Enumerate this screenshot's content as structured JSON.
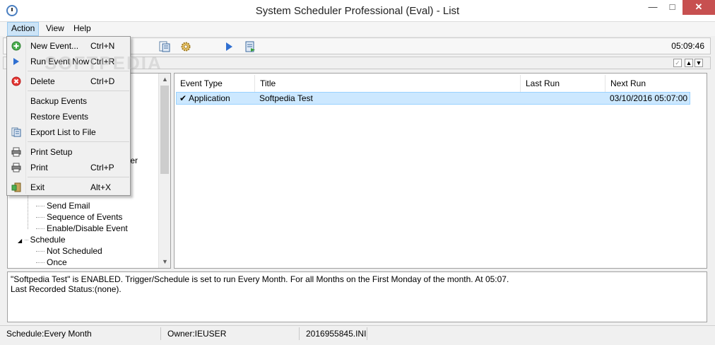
{
  "window": {
    "title": "System Scheduler Professional (Eval) - List",
    "close_glyph": "✕",
    "min_glyph": "—",
    "max_glyph": "□"
  },
  "menubar": {
    "action": "Action",
    "view": "View",
    "help": "Help"
  },
  "toolbar": {
    "clock": "05:09:46",
    "icons": [
      "export-list-icon",
      "settings-gear-icon",
      "run-icon",
      "import-icon"
    ]
  },
  "action_menu": {
    "items": [
      {
        "label": "New Event...",
        "shortcut": "Ctrl+N",
        "icon": "add-green-icon"
      },
      {
        "label": "Run Event Now",
        "shortcut": "Ctrl+R",
        "icon": "play-icon"
      },
      {
        "label": "Delete",
        "shortcut": "Ctrl+D",
        "icon": "delete-red-icon"
      },
      {
        "label": "Backup Events",
        "shortcut": ""
      },
      {
        "label": "Restore Events",
        "shortcut": ""
      },
      {
        "label": "Export List to File",
        "shortcut": "",
        "icon": "export-list-icon"
      },
      {
        "label": "Print Setup",
        "shortcut": "",
        "icon": "printer-icon"
      },
      {
        "label": "Print",
        "shortcut": "Ctrl+P",
        "icon": "printer-icon"
      },
      {
        "label": "Exit",
        "shortcut": "Alt+X",
        "icon": "exit-icon"
      }
    ]
  },
  "tree": {
    "partial_label": "ter",
    "items": [
      "Send Email",
      "Sequence of Events",
      "Enable/Disable Event"
    ],
    "schedule_label": "Schedule",
    "schedule_items": [
      "Not Scheduled",
      "Once"
    ]
  },
  "list": {
    "columns": [
      "Event Type",
      "Title",
      "Last Run",
      "Next Run"
    ],
    "rows": [
      {
        "event_type": "Application",
        "title": "Softpedia Test",
        "last_run": "",
        "next_run": "03/10/2016 05:07:00"
      }
    ],
    "check_glyph": "✔"
  },
  "status_panel": {
    "line1": "\"Softpedia Test\" is ENABLED. Trigger/Schedule is set to run Every Month. For all Months on the First Monday of the month. At 05:07.",
    "line2": "Last Recorded Status:(none)."
  },
  "statusbar": {
    "schedule": "Schedule:Every Month",
    "owner": "Owner:IEUSER",
    "file": "2016955845.INI"
  },
  "watermark": "SOFTPEDIA"
}
